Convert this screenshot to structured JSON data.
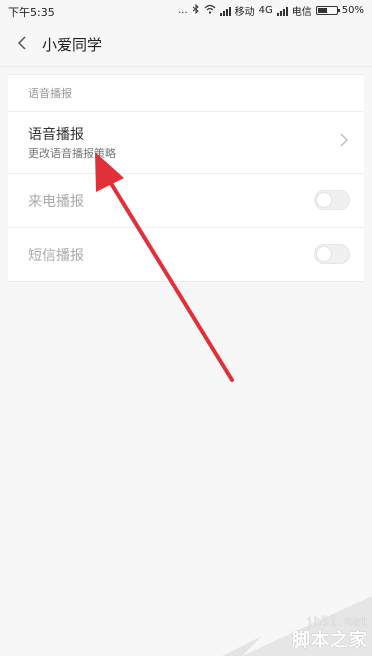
{
  "status_bar": {
    "time": "下午5:35",
    "dots": "...",
    "carrier1": "移动",
    "network": "4G",
    "carrier2": "电信",
    "battery": "50%",
    "battery_level": 0.5
  },
  "header": {
    "title": "小爱同学",
    "back_icon": "chevron-left-icon"
  },
  "section": {
    "label": "语音播报"
  },
  "rows": [
    {
      "title": "语音播报",
      "subtitle": "更改语音播报策略",
      "icon": "chevron-right-icon"
    },
    {
      "title": "来电播报",
      "toggle_on": false
    },
    {
      "title": "短信播报",
      "toggle_on": false
    }
  ],
  "watermark": {
    "site": "jb51.net",
    "name": "脚本之家"
  },
  "colors": {
    "background": "#f7f7f7",
    "card": "#ffffff",
    "annotation": "#e0303a",
    "disabled_text": "#aaaaaa"
  }
}
